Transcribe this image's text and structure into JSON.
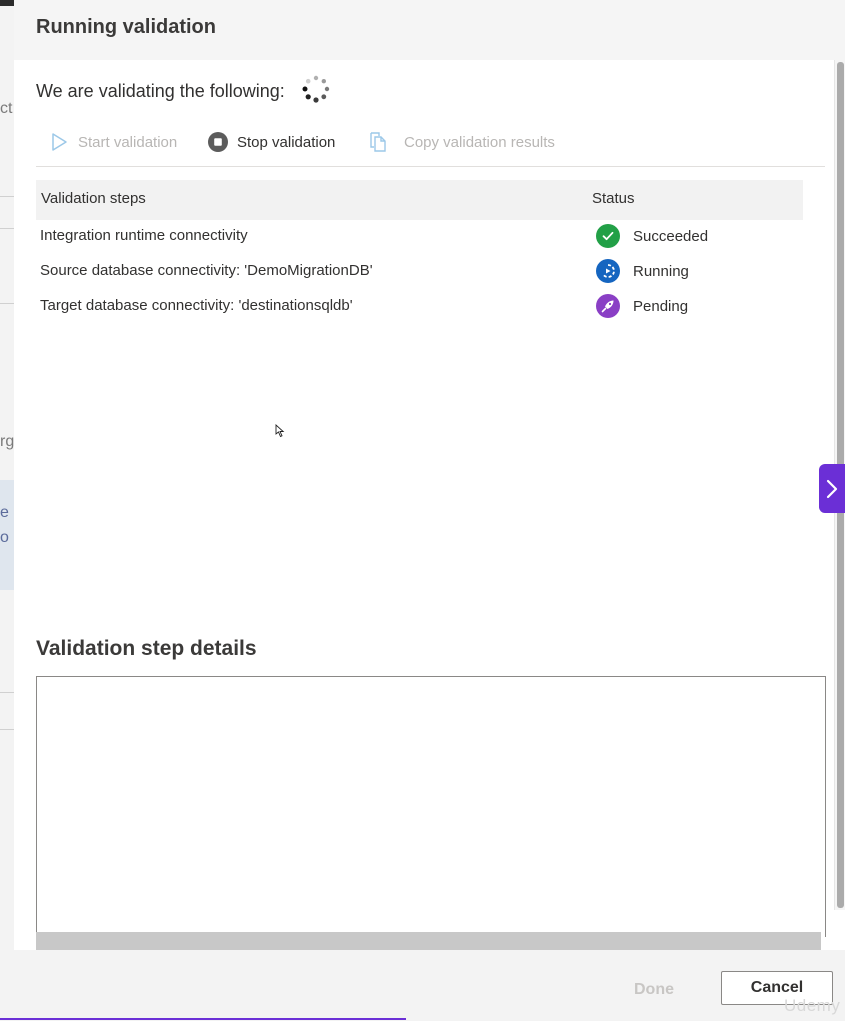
{
  "background": {
    "fragments": [
      "ct",
      "rg",
      "e S",
      "o l"
    ]
  },
  "dialog": {
    "title": "Running validation",
    "intro": "We are validating the following:",
    "spinner_icon": "loading-spinner-icon"
  },
  "toolbar": {
    "start_label": "Start validation",
    "stop_label": "Stop validation",
    "copy_label": "Copy validation results"
  },
  "table": {
    "headers": {
      "step": "Validation steps",
      "status": "Status"
    },
    "rows": [
      {
        "step": "Integration runtime connectivity",
        "status": "Succeeded",
        "icon": "check-circle-icon",
        "color": "#22a047"
      },
      {
        "step": "Source database connectivity: 'DemoMigrationDB'",
        "status": "Running",
        "icon": "running-icon",
        "color": "#1565c0"
      },
      {
        "step": "Target database connectivity: 'destinationsqldb'",
        "status": "Pending",
        "icon": "rocket-icon",
        "color": "#8a3fc5"
      }
    ]
  },
  "details": {
    "title": "Validation step details"
  },
  "footer": {
    "done_label": "Done",
    "cancel_label": "Cancel"
  },
  "watermark": "Udemy",
  "colors": {
    "accent": "#6b2fd6",
    "success": "#22a047",
    "running": "#1565c0",
    "pending": "#8a3fc5"
  }
}
